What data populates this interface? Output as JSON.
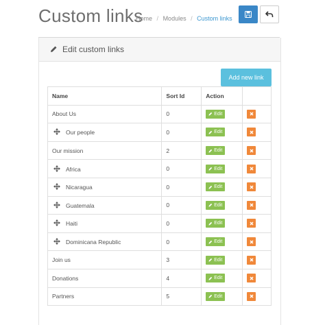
{
  "header": {
    "title": "Custom links",
    "breadcrumb": [
      "Home",
      "Modules",
      "Custom links"
    ]
  },
  "panel": {
    "title": "Edit custom links",
    "add_button_label": "Add new link"
  },
  "table": {
    "columns": [
      "Name",
      "Sort Id",
      "Action"
    ],
    "edit_label": "Edit",
    "rows": [
      {
        "name": "About Us",
        "sort_id": "0",
        "child": false
      },
      {
        "name": "Our people",
        "sort_id": "0",
        "child": true
      },
      {
        "name": "Our mission",
        "sort_id": "2",
        "child": false
      },
      {
        "name": "Africa",
        "sort_id": "0",
        "child": true
      },
      {
        "name": "Nicaragua",
        "sort_id": "0",
        "child": true
      },
      {
        "name": "Guatemala",
        "sort_id": "0",
        "child": true
      },
      {
        "name": "Haiti",
        "sort_id": "0",
        "child": true
      },
      {
        "name": "Dominicana Republic",
        "sort_id": "0",
        "child": true
      },
      {
        "name": "Join us",
        "sort_id": "3",
        "child": false
      },
      {
        "name": "Donations",
        "sort_id": "4",
        "child": false
      },
      {
        "name": "Partners",
        "sort_id": "5",
        "child": false
      }
    ]
  },
  "colors": {
    "primary": "#3a87c7",
    "info": "#5bc0de",
    "success": "#8cc152",
    "warning": "#f0883a",
    "breadcrumb_active": "#3a96d0"
  },
  "icons": {
    "save": "floppy-disk-icon",
    "back": "undo-arrow-icon",
    "panel": "pencil-icon",
    "move": "move-arrows-icon",
    "edit": "pencil-icon",
    "delete": "close-icon"
  }
}
